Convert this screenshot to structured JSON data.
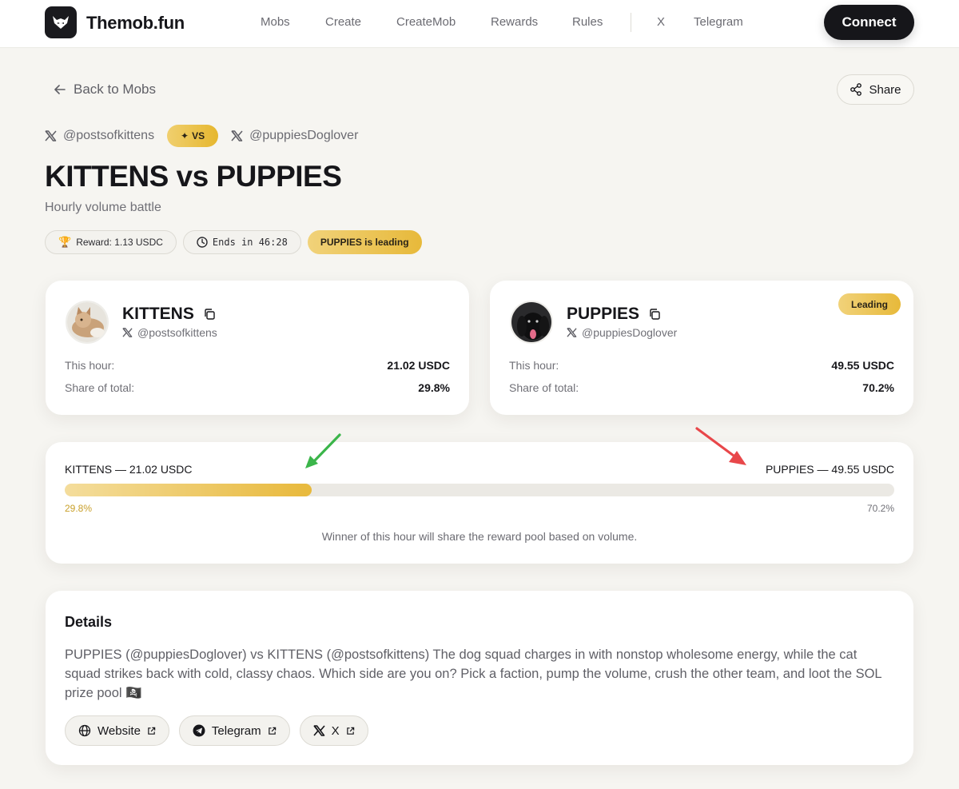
{
  "app": {
    "brand": "Themob.fun",
    "nav": [
      "Mobs",
      "Create",
      "CreateMob",
      "Rewards",
      "Rules",
      "X",
      "Telegram"
    ],
    "connect_label": "Connect"
  },
  "page": {
    "back_label": "Back to Mobs",
    "share_label": "Share",
    "handle_left": "@postsofkittens",
    "vs_label": "VS",
    "handle_right": "@puppiesDoglover",
    "title": "KITTENS vs PUPPIES",
    "subtitle": "Hourly volume battle",
    "reward": "Reward: 1.13 USDC",
    "ends": "Ends in 46:28",
    "leading_status": "PUPPIES is leading"
  },
  "teams": [
    {
      "name": "KITTENS",
      "handle": "@postsofkittens",
      "hour_label": "This hour:",
      "hour_value": "21.02 USDC",
      "share_label": "Share of total:",
      "share_value": "29.8%",
      "leading": false
    },
    {
      "name": "PUPPIES",
      "handle": "@puppiesDoglover",
      "hour_label": "This hour:",
      "hour_value": "49.55 USDC",
      "share_label": "Share of total:",
      "share_value": "70.2%",
      "leading": true,
      "leading_label": "Leading"
    }
  ],
  "battle_bar": {
    "left_label": "KITTENS — 21.02 USDC",
    "right_label": "PUPPIES — 49.55 USDC",
    "left_fraction": 0.298,
    "left_pct": "29.8%",
    "right_pct": "70.2%",
    "note": "Winner of this hour will share the reward pool based on volume."
  },
  "details": {
    "title": "Details",
    "body": "PUPPIES (@puppiesDoglover) vs KITTENS (@postsofkittens) The dog squad charges in with nonstop wholesome energy, while the cat squad strikes back with cold, classy chaos. Which side are you on? Pick a faction, pump the volume, crush the other team, and loot the SOL prize pool 🏴‍☠️",
    "links": [
      "Website",
      "Telegram",
      "X"
    ]
  },
  "colors": {
    "accent_gold": "#e7b93a",
    "dark": "#16161a",
    "annotation_green": "#3bb54a",
    "annotation_red": "#e8474a"
  }
}
